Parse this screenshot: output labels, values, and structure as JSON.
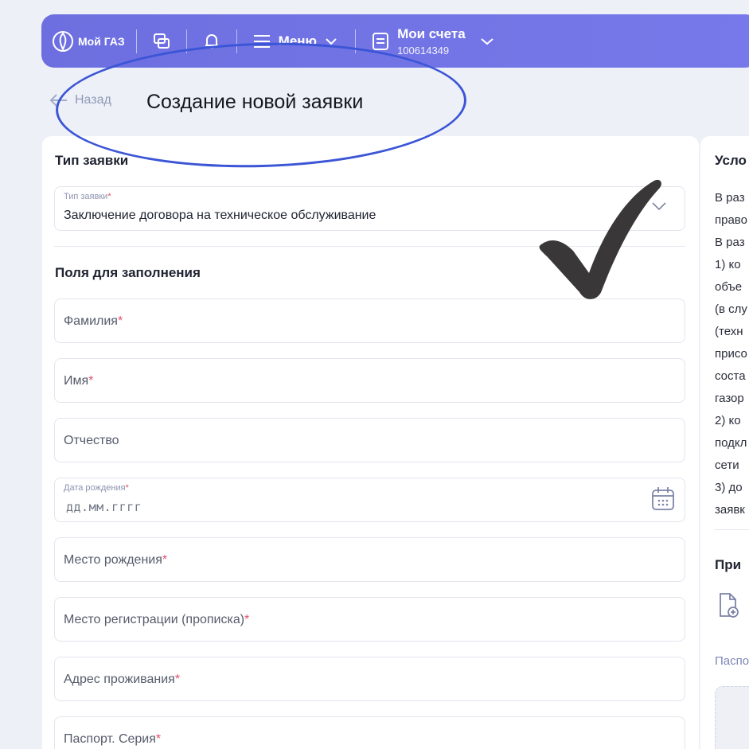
{
  "header": {
    "logo": "Мой ГАЗ",
    "menu_label": "Меню",
    "accounts_label": "Мои счета",
    "account_number": "100614349"
  },
  "nav": {
    "back_label": "Назад",
    "page_title": "Создание новой заявки"
  },
  "form": {
    "type_section_title": "Тип заявки",
    "type_field": {
      "label": "Тип заявки",
      "value": "Заключение договора на техническое обслуживание"
    },
    "fields_section_title": "Поля для заполнения",
    "fields": [
      {
        "label": "Фамилия",
        "required": "*"
      },
      {
        "label": "Имя",
        "required": "*"
      },
      {
        "label": "Отчество",
        "required": ""
      },
      {
        "label": "Дата рождения",
        "required": "*",
        "placeholder": "дд.мм.гггг"
      },
      {
        "label": "Место рождения",
        "required": "*"
      },
      {
        "label": "Место регистрации (прописка)",
        "required": "*"
      },
      {
        "label": "Адрес проживания",
        "required": "*"
      },
      {
        "label": "Паспорт. Серия",
        "required": "*"
      }
    ]
  },
  "right_panel": {
    "title": "Усло",
    "lines": [
      "В раз",
      "право",
      "В раз",
      "1) ко",
      "объе",
      "(в слу",
      "(техн",
      "присо",
      "соста",
      "газор",
      "2) ко",
      "подкл",
      "сети",
      "3) до",
      "заявк"
    ],
    "attachments_title": "При",
    "attachment_link": "Паспо"
  },
  "colors": {
    "header": "#6d6fe0",
    "annotation_ellipse": "#3b55d6",
    "required": "#e0516f"
  }
}
